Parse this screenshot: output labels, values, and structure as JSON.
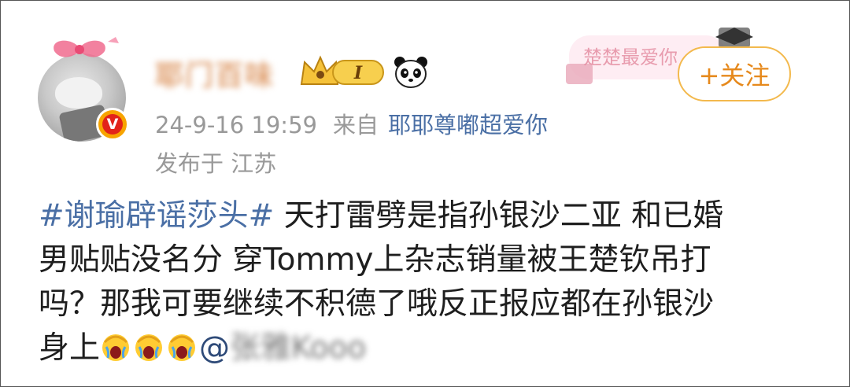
{
  "user": {
    "name": "耶门百味",
    "avatar_badge": "V",
    "level_badge": "I"
  },
  "meta": {
    "timestamp": "24-9-16 19:59",
    "from_prefix": "来自",
    "source": "耶耶尊嘟超爱你",
    "location_prefix": "发布于",
    "location": "江苏"
  },
  "decoration": {
    "text": "楚楚最爱你"
  },
  "follow_button": {
    "label": "+关注"
  },
  "post": {
    "hashtag": "#谢瑜辟谣莎头#",
    "line1_text": "天打雷劈是指孙银沙二亚 和已婚",
    "line2": "男贴贴没名分 穿Tommy上杂志销量被王楚钦吊打",
    "line3": "吗？那我可要继续不积德了哦反正报应都在孙银沙",
    "line4_text": "身上",
    "mention_at": "@",
    "mention_name": "张雅Kooo"
  },
  "colors": {
    "link": "#4a6fa5",
    "follow_border": "#f3b94d",
    "follow_text": "#e6891c",
    "meta_gray": "#999999"
  }
}
